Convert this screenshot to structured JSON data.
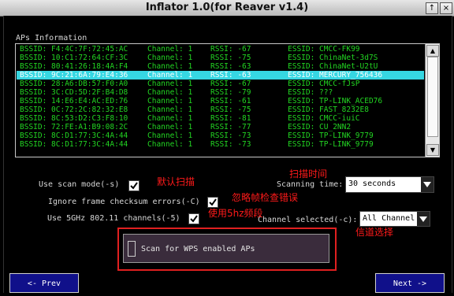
{
  "window": {
    "title": "Inflator 1.0(for Reaver v1.4)",
    "btn_up": "↑",
    "btn_close": "×"
  },
  "ap_list": {
    "label": "APs Information",
    "rows": [
      {
        "bssid": "BSSID: F4:4C:7F:72:45:AC",
        "channel": "Channel: 1",
        "rssi": "RSSI: -67",
        "essid": "ESSID: CMCC-FK99"
      },
      {
        "bssid": "BSSID: 10:C1:72:64:CF:3C",
        "channel": "Channel: 1",
        "rssi": "RSSI: -75",
        "essid": "ESSID: ChinaNet-3d7S"
      },
      {
        "bssid": "BSSID: 80:41:26:18:4A:F4",
        "channel": "Channel: 1",
        "rssi": "RSSI: -63",
        "essid": "ESSID: ChinaNet-U2tU"
      },
      {
        "bssid": "BSSID: 9C:21:6A:79:E4:36",
        "channel": "Channel: 1",
        "rssi": "RSSI: -63",
        "essid": "ESSID: MERCURY_756436"
      },
      {
        "bssid": "BSSID: 28:A6:DB:57:F0:A0",
        "channel": "Channel: 1",
        "rssi": "RSSI: -67",
        "essid": "ESSID: CMCC-fJsP"
      },
      {
        "bssid": "BSSID: 3C:CD:5D:2F:B4:D8",
        "channel": "Channel: 1",
        "rssi": "RSSI: -79",
        "essid": "ESSID: ???"
      },
      {
        "bssid": "BSSID: 14:E6:E4:AC:ED:76",
        "channel": "Channel: 1",
        "rssi": "RSSI: -61",
        "essid": "ESSID: TP-LINK_ACED76"
      },
      {
        "bssid": "BSSID: 0C:72:2C:82:32:E8",
        "channel": "Channel: 1",
        "rssi": "RSSI: -75",
        "essid": "ESSID: FAST_8232E8"
      },
      {
        "bssid": "BSSID: 8C:53:D2:C3:F8:10",
        "channel": "Channel: 1",
        "rssi": "RSSI: -81",
        "essid": "ESSID: CMCC-iuiC"
      },
      {
        "bssid": "BSSID: 72:FE:A1:B9:08:2C",
        "channel": "Channel: 1",
        "rssi": "RSSI: -77",
        "essid": "ESSID: CU_2NN2"
      },
      {
        "bssid": "BSSID: 8C:D1:77:3C:4A:44",
        "channel": "Channel: 1",
        "rssi": "RSSI: -73",
        "essid": "ESSID: TP-LINK_9779"
      },
      {
        "bssid": "BSSID: 8C:D1:77:3C:4A:44",
        "channel": "Channel: 1",
        "rssi": "RSSI: -73",
        "essid": "ESSID: TP-LINK_9779"
      }
    ],
    "selected_index": 3
  },
  "options": {
    "scan_mode": "Use scan mode(-s)",
    "ignore_checksum": "Ignore frame checksum errors(-C)",
    "use_5ghz": "Use 5GHz 802.11 channels(-5)",
    "scanning_time_label": "Scanning time:",
    "scanning_time_value": "30 seconds",
    "channel_label": "Channel selected(-c):",
    "channel_value": "All Channel"
  },
  "annotations": {
    "scan_mode": "默认扫描",
    "scan_time": "扫描时间",
    "checksum": "忽略帧检查错误",
    "five_ghz": "使用5hz频段",
    "channel": "信道选择"
  },
  "wps_scan": {
    "label": "Scan for WPS enabled APs"
  },
  "nav": {
    "prev": "<- Prev",
    "next": "Next ->"
  },
  "colors": {
    "list_text": "#22d522",
    "selected_row": "#36d7e2",
    "annotation": "#ff1a1a",
    "nav_button": "#10108a"
  }
}
